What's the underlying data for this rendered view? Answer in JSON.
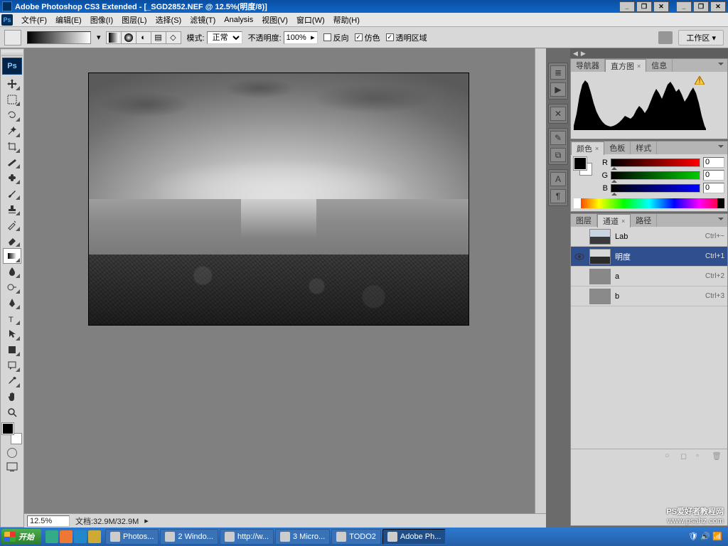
{
  "titlebar": {
    "title": "Adobe Photoshop CS3 Extended - [_SGD2852.NEF @ 12.5%(明度/8)]"
  },
  "menu": {
    "file": "文件(F)",
    "edit": "编辑(E)",
    "image": "图像(I)",
    "layer": "图层(L)",
    "select": "选择(S)",
    "filter": "滤镜(T)",
    "analysis": "Analysis",
    "view": "视图(V)",
    "window": "窗口(W)",
    "help": "帮助(H)"
  },
  "options": {
    "mode_label": "模式:",
    "mode_value": "正常",
    "opacity_label": "不透明度:",
    "opacity_value": "100%",
    "reverse": "反向",
    "dither": "仿色",
    "transparency": "透明区域",
    "workspace": "工作区"
  },
  "status": {
    "zoom": "12.5%",
    "doc": "文档:32.9M/32.9M"
  },
  "panels": {
    "navigator": "导航器",
    "histogram": "直方图",
    "info": "信息",
    "color": "颜色",
    "swatches": "色板",
    "styles": "样式",
    "layers": "图层",
    "channels": "通道",
    "paths": "路径"
  },
  "color": {
    "r_label": "R",
    "g_label": "G",
    "b_label": "B",
    "r_val": "0",
    "g_val": "0",
    "b_val": "0"
  },
  "channels": [
    {
      "name": "Lab",
      "shortcut": "Ctrl+~",
      "visible": false,
      "active": false,
      "thumb": "lab"
    },
    {
      "name": "明度",
      "shortcut": "Ctrl+1",
      "visible": true,
      "active": true,
      "thumb": "lum"
    },
    {
      "name": "a",
      "shortcut": "Ctrl+2",
      "visible": false,
      "active": false,
      "thumb": "a"
    },
    {
      "name": "b",
      "shortcut": "Ctrl+3",
      "visible": false,
      "active": false,
      "thumb": "b"
    }
  ],
  "taskbar": {
    "start": "开始",
    "tasks": [
      {
        "label": "Photos..."
      },
      {
        "label": "2 Windo..."
      },
      {
        "label": "http://w..."
      },
      {
        "label": "3 Micro..."
      },
      {
        "label": "TODO2"
      },
      {
        "label": "Adobe Ph..."
      }
    ]
  },
  "watermark": {
    "line1": "PS爱好者教程网",
    "line2": "www.psahz.com"
  }
}
